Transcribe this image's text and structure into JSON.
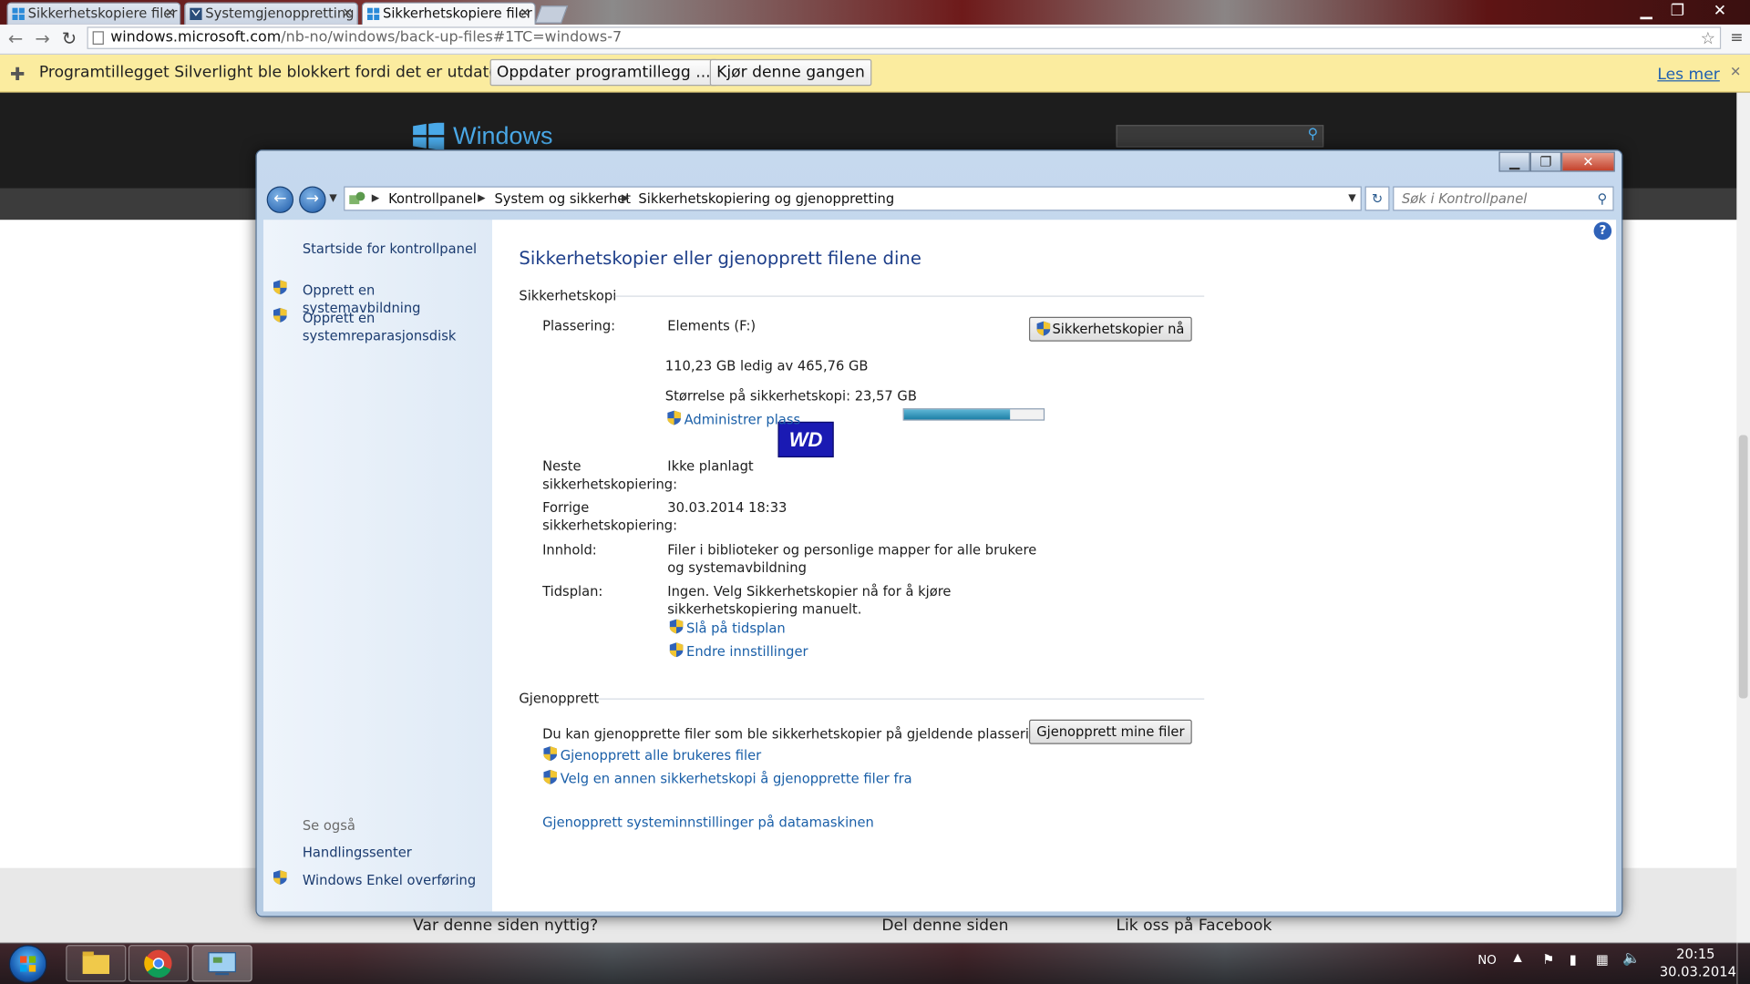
{
  "browser": {
    "tabs": [
      {
        "label": "Sikkerhetskopiere filer",
        "active": false
      },
      {
        "label": "Systemgjenoppretting",
        "active": false
      },
      {
        "label": "Sikkerhetskopiere filer",
        "active": true
      }
    ],
    "url_host": "windows.microsoft.com",
    "url_path": "/nb-no/windows/back-up-files#1TC=windows-7"
  },
  "infobar": {
    "message": "Programtillegget Silverlight ble blokkert fordi det er utdatert.",
    "update_button": "Oppdater programtillegg ...",
    "run_button": "Kjør denne gangen",
    "learn_more": "Les mer"
  },
  "webpage": {
    "brand": "Windows",
    "footer_links": [
      "Var denne siden nyttig?",
      "Del denne siden",
      "Lik oss på Facebook"
    ]
  },
  "window": {
    "breadcrumb": [
      "Kontrollpanel",
      "System og sikkerhet",
      "Sikkerhetskopiering og gjenoppretting"
    ],
    "search_placeholder": "Søk i Kontrollpanel",
    "left_pane": {
      "home": "Startside for kontrollpanel",
      "items": [
        "Opprett en systemavbildning",
        "Opprett en",
        "systemreparasjonsdisk"
      ],
      "see_also_title": "Se også",
      "see_also": [
        "Handlingssenter",
        "Windows Enkel overføring"
      ]
    },
    "main": {
      "title": "Sikkerhetskopier eller gjenopprett filene dine",
      "backup_group": "Sikkerhetskopi",
      "location_label": "Plassering:",
      "drive_name": "Elements (F:)",
      "drive_used_fraction": 0.763,
      "drive_logo": "WD",
      "free_space": "110,23 GB ledig av 465,76 GB",
      "backup_size": "Størrelse på sikkerhetskopi: 23,57 GB",
      "manage_space": "Administrer plass",
      "backup_now_button": "Sikkerhetskopier nå",
      "next_label_1": "Neste",
      "next_label_2": "sikkerhetskopiering:",
      "next_value": "Ikke planlagt",
      "last_label_1": "Forrige",
      "last_label_2": "sikkerhetskopiering:",
      "last_value": "30.03.2014 18:33",
      "contents_label": "Innhold:",
      "contents_value_1": "Filer i biblioteker og personlige mapper for alle brukere",
      "contents_value_2": "og systemavbildning",
      "schedule_label": "Tidsplan:",
      "schedule_value_1": "Ingen. Velg Sikkerhetskopier nå for å kjøre",
      "schedule_value_2": "sikkerhetskopiering manuelt.",
      "turn_on_schedule": "Slå på tidsplan",
      "change_settings": "Endre innstillinger",
      "restore_group": "Gjenopprett",
      "restore_text": "Du kan gjenopprette filer som ble sikkerhetskopier på gjeldende plassering.",
      "restore_button": "Gjenopprett mine filer",
      "restore_all_users": "Gjenopprett alle brukeres filer",
      "choose_other_backup": "Velg en annen sikkerhetskopi å gjenopprette filer fra",
      "recover_system": "Gjenopprett systeminnstillinger på datamaskinen"
    }
  },
  "taskbar": {
    "language": "NO",
    "time": "20:15",
    "date": "30.03.2014"
  }
}
